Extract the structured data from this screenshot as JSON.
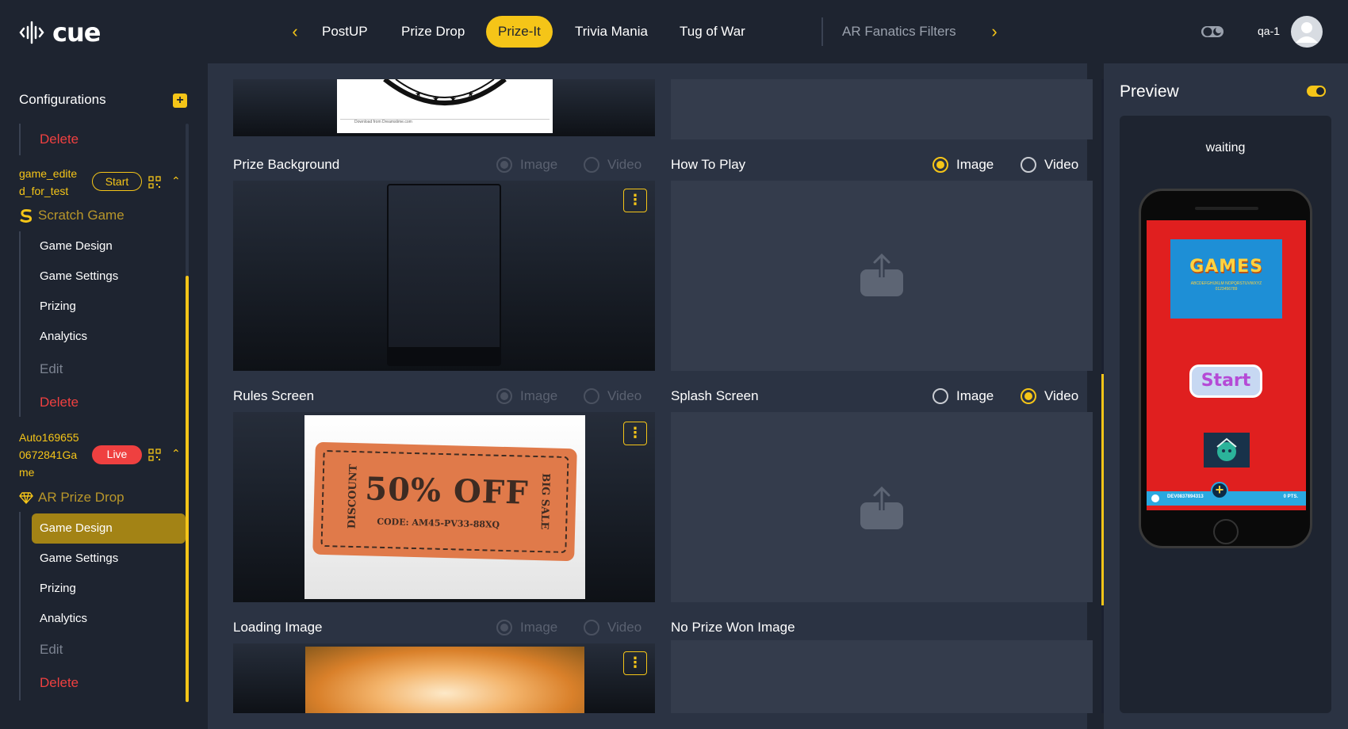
{
  "app": {
    "logo_text": "cue"
  },
  "nav": {
    "tabs": [
      {
        "label": "PostUP"
      },
      {
        "label": "Prize Drop"
      },
      {
        "label": "Prize-It"
      },
      {
        "label": "Trivia Mania"
      },
      {
        "label": "Tug of War"
      },
      {
        "label": "AR Fanatics Filters"
      }
    ],
    "active_tab": "Prize-It",
    "user": "qa-1",
    "accent_color": "#f5c518"
  },
  "sidebar": {
    "title": "Configurations",
    "top_delete": "Delete",
    "game1": {
      "name_line1": "game_edite",
      "name_line2": "d_for_test",
      "status_button": "Start",
      "type": "Scratch Game",
      "items": [
        "Game Design",
        "Game Settings",
        "Prizing",
        "Analytics"
      ],
      "edit": "Edit",
      "delete": "Delete"
    },
    "game2": {
      "name_line1": "Auto169655",
      "name_line2": "0672841Ga",
      "name_line3": "me",
      "status_button": "Live",
      "type": "AR Prize Drop",
      "items": [
        "Game Design",
        "Game Settings",
        "Prizing",
        "Analytics"
      ],
      "active_item": "Game Design",
      "edit": "Edit",
      "delete": "Delete"
    }
  },
  "main": {
    "options": {
      "image": "Image",
      "video": "Video"
    },
    "sections": {
      "prize_background": {
        "label": "Prize Background",
        "selected": "Image",
        "enabled": false
      },
      "how_to_play": {
        "label": "How To Play",
        "selected": "Image",
        "enabled": true
      },
      "rules_screen": {
        "label": "Rules Screen",
        "selected": "Image",
        "enabled": false
      },
      "splash_screen": {
        "label": "Splash Screen",
        "selected": "Video",
        "enabled": true
      },
      "loading_image": {
        "label": "Loading Image",
        "selected": "Image",
        "enabled": false
      },
      "no_prize_won_image": {
        "label": "No Prize Won Image"
      }
    },
    "coupon": {
      "left_text": "DISCOUNT",
      "big_text": "50% OFF",
      "code": "CODE: AM45-PV33-88XQ",
      "right_text": "BIG SALE"
    },
    "stamp_caption": "Download from Dreamstime.com"
  },
  "preview": {
    "title": "Preview",
    "status": "waiting",
    "screen": {
      "banner_title": "GAMES",
      "banner_sub": "ABCDEFGHIJKLM NOPQRSTUVWXYZ 0123456789",
      "start_button": "Start",
      "footer_id": "DEV0837894313",
      "footer_pts": "0 PTS."
    }
  }
}
